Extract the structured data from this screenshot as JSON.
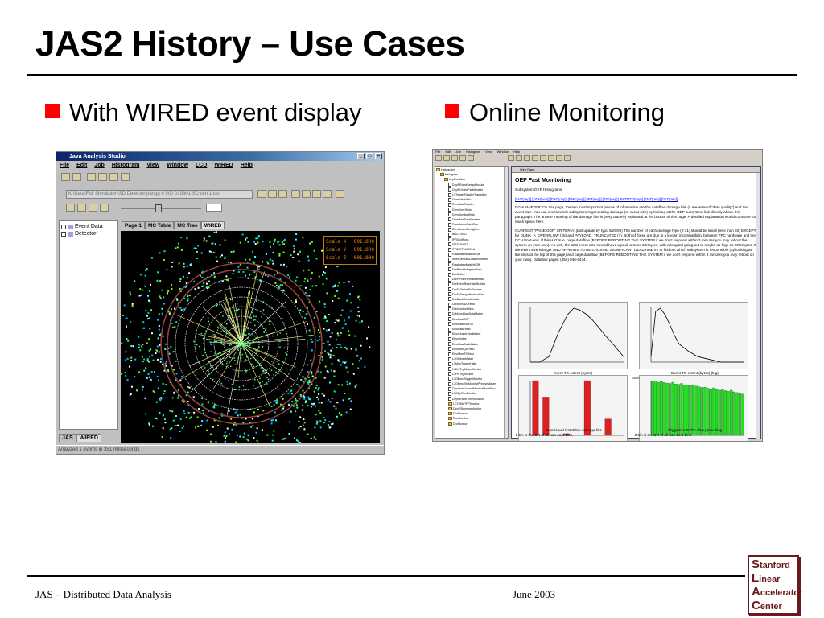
{
  "slide": {
    "title": "JAS2 History – Use Cases",
    "bullets": [
      "With WIRED event display",
      "Online Monitoring"
    ],
    "footer_left": "JAS – Distributed Data Analysis",
    "footer_right": "June  2003",
    "logo": [
      {
        "initial": "S",
        "rest": "tanford"
      },
      {
        "initial": "L",
        "rest": "inear"
      },
      {
        "initial": "A",
        "rest": "ccelerator"
      },
      {
        "initial": "C",
        "rest": "enter"
      }
    ],
    "accent_color": "#ff0000"
  },
  "jas": {
    "window_title": "Java Analysis Studio",
    "menu": [
      "File",
      "Edit",
      "Job",
      "Histogram",
      "View",
      "Window",
      "LCD",
      "WIRED",
      "Help"
    ],
    "path": "K:\\Data\\Full Simulation\\SD Detector\\pangg h 500 010301 SD sim 1.sio",
    "tree": [
      "Event Data",
      "Detector"
    ],
    "tabs": [
      "Page 1",
      "MC Table",
      "MC Tree",
      "WIRED"
    ],
    "bottom_tabs": [
      "JAS",
      "WIRED"
    ],
    "status": "Analyzed 1 events in 351 milliseconds",
    "scale": [
      {
        "label": "Scale X",
        "value": "001.000"
      },
      {
        "label": "Scale Y",
        "value": "001.000"
      },
      {
        "label": "Scale Z",
        "value": "001.000"
      }
    ]
  },
  "om": {
    "menu": [
      "File",
      "Edit",
      "Job",
      "Histogram",
      "View",
      "Window",
      "Help"
    ],
    "window_title": "Web Page",
    "tree_root": [
      "Histograms",
      "histogram",
      "oepRunMon"
    ],
    "tree_items": [
      "DepPEventSetupModule",
      "DepPOnlineFastModule",
      "L1TriggerReaderTransition",
      "DemDataHisto",
      "DemDataReader",
      "DemErrorHisto",
      "DemMonitorHisto",
      "DemRawDataReader",
      "DemNexusDataRea",
      "DemBeamConfigItem",
      "BBOT4ITO",
      "IFRIGotPoss",
      "ISTDOMIST",
      "IPREMTLAMOLA",
      "RawDatanMatchInOff",
      "InnerDetRawDataHistoRaw",
      "RawDatanMatchInOff",
      "DrcRawHistogramRaw",
      "DrcOnline",
      "DrcPtFranRemakeHistBc",
      "DrcEventRawHistoBuilder",
      "DrcFsOnlineEnParams",
      "DrcEvDelayHistoModule",
      "DrcBackHistoModule",
      "DrcMonTDCHisto",
      "DchMonitorHisto",
      "DchMonRawDataMaker",
      "EmcFastTOF",
      "EmcFastTdcFull",
      "EmcRawHisto",
      "EmcClusterMonMaker",
      "EmcOnline",
      "EmcRawCalibMaker",
      "EmcMonQAHisto",
      "EmcMonTSHisto",
      "L1GtHistoMaker",
      "L1MonTriggerHisto",
      "L1DctTrgMakerMonitor",
      "L1PhiTrgMonitor",
      "L1OEmcTriggerMonitor",
      "L1OEmcTrigMonitorPreciseMaker",
      "DepLineConvertMonitorNodeProc",
      "L3OEpRunMonitor",
      "DepPEventTimerModule",
      "LCTriStdTFFMonitor",
      "DepPSkimmerMonitor",
      "DrcMonitor",
      "RunMonitor",
      "DrcMonitor"
    ],
    "page_heading": "OEP Fast Monitoring",
    "subsystem_label": "Subsystem OEP Histograms:",
    "links": "[SVT(oep)] [DCH(oep)] [DRC(oep)] [EMC(oep)] [IFR(oep)] [TSF(oep)] [BLT/PTD(oep)] [EMT(oep)] [GLT(oep)]",
    "para1": "DGM SHIFTER: On this page, the two most important pieces of information are the dataflow damage bits (a measure of \"data quality\") and the event size. You can check which subsystem is generating damage (or event size) by looking at the OEP subsystem link directly above this paragraph. The arcane meaning of the damage bits is (very crudely) explained at the bottom of this page. A detailed explanation would consume too much space here.",
    "para2": "CURRENT \"PAGE ODF\" CRITERIA: (last update by typo 9/29/99) The number of each damage type (0-31) should be small (less than 50) EXCEPT for DLINK_A_OVERFLOW (25) and PAYLOAD_TRUNCATED (7). Both of these are due to a known incompatibility between TPC hardware and the DCH front-end. If this isn't true, page dataflow (BEFORE REBOOTING THE SYSTEM if we don't respond within 3 minutes you may reboot the system on your own). As well, the total event size should have a peak around 30Kbytes, with a long tail going out to maybe as high as 200Kbytes. If the event size is larger AND APPEARS TO BE CAUSING SIGNIFICANT DEADTIME try to find out which subsystem is responsible (by looking at the links at the top of this page) and page dataflow (BEFORE REBOOTING THE SYSTEM if we don't respond within 3 minutes you may reboot on your own). Dataflow pager: (650) 846-8474.",
    "hist_captions": [
      {
        "l1": "Event TC extent (bytes)",
        "l2": ""
      },
      {
        "l1": "Event TC extent (bytes) (big)",
        "l2": "Same as left histogram, with a longer X axis range"
      },
      {
        "l1": "Event-level DataFlow damage bits",
        "l2": "~1 bin is the OR of all non-zero bins"
      },
      {
        "l1": "Triggers in FCTS after prescaling",
        "l2": "~2 bin is the OR of all non-zero bins"
      }
    ]
  },
  "chart_data": [
    {
      "type": "line",
      "title": "Event TC extent (bytes)",
      "x": [
        0,
        6000,
        12000,
        18000,
        24000,
        28000,
        32000,
        36000,
        40000,
        44000,
        48000,
        54000,
        60000
      ],
      "values": [
        0,
        0,
        2,
        40,
        400,
        900,
        700,
        420,
        200,
        80,
        30,
        8,
        2
      ],
      "y_scale": "log",
      "xlim": [
        0,
        60000
      ],
      "ylim": [
        1,
        1000
      ]
    },
    {
      "type": "line",
      "title": "Event TC extent (bytes) (big)",
      "x": [
        0,
        0.1,
        0.2,
        0.3,
        0.4,
        0.5,
        0.6,
        0.8,
        1.0,
        1.5,
        2.0
      ],
      "values": [
        2,
        600,
        900,
        400,
        120,
        30,
        10,
        4,
        2,
        1,
        1
      ],
      "y_scale": "log",
      "xlim": [
        0,
        2
      ],
      "ylim": [
        1,
        1000
      ]
    },
    {
      "type": "bar",
      "title": "Event-level DataFlow damage bits",
      "categories": [
        "0",
        "1",
        "5",
        "7",
        "10",
        "15",
        "20",
        "25",
        "30"
      ],
      "values": [
        1000,
        700,
        0,
        30,
        0,
        1000,
        0,
        300,
        0
      ],
      "ylim": [
        0,
        1000
      ]
    },
    {
      "type": "bar",
      "title": "Triggers in FCTS after prescaling",
      "categories": [
        "0",
        "1",
        "2",
        "3",
        "4",
        "5",
        "6",
        "7",
        "8",
        "9",
        "10",
        "11",
        "12",
        "13",
        "14",
        "15",
        "16",
        "17",
        "18",
        "19",
        "20",
        "21",
        "22",
        "23",
        "24",
        "25",
        "26",
        "27",
        "28",
        "29",
        "30",
        "31"
      ],
      "values": [
        900,
        860,
        820,
        900,
        780,
        740,
        700,
        820,
        660,
        620,
        700,
        580,
        560,
        540,
        600,
        500,
        460,
        420,
        440,
        380,
        360,
        400,
        320,
        300,
        340,
        280,
        260,
        300,
        240,
        220,
        200,
        180
      ],
      "y_scale": "log",
      "ylim": [
        1,
        1000
      ]
    }
  ]
}
